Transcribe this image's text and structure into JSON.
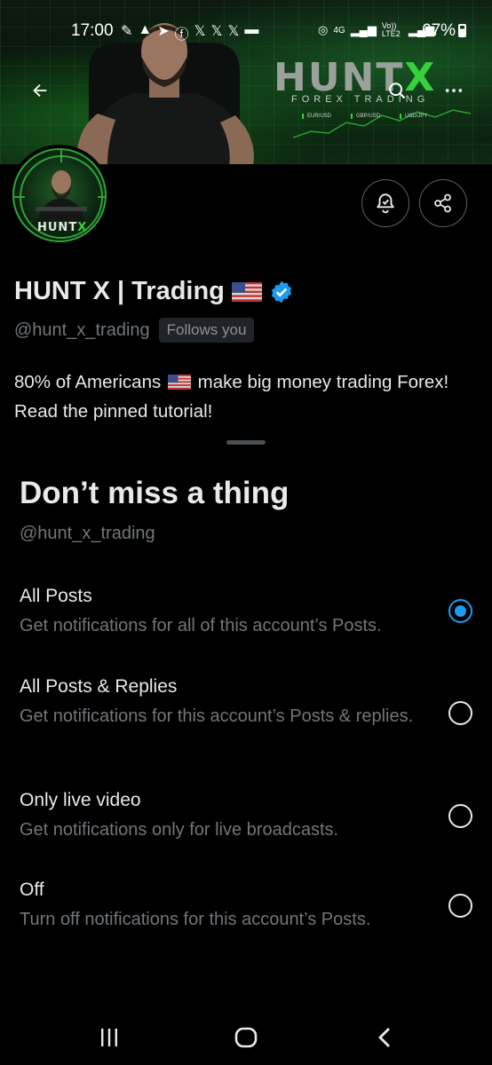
{
  "status_bar": {
    "time": "17:00",
    "left_icons": [
      "edit-icon",
      "alert-icon",
      "telegram-icon",
      "facebook-icon",
      "x-icon",
      "x-icon",
      "x-icon",
      "folder-icon"
    ],
    "right_icons": [
      "hotspot-icon",
      "4g-icon",
      "signal-icon",
      "volte-icon",
      "signal-icon"
    ],
    "network": "4G",
    "volte": "Vo)) LTE2",
    "battery": "67%"
  },
  "banner": {
    "brand_main": "HUNT",
    "brand_x": "X",
    "brand_sub": "FOREX TRADING",
    "tickers": [
      "EUR/USD",
      "GBP/USD",
      "USD/JPY"
    ]
  },
  "header": {
    "back_icon": "arrow-left-icon",
    "search_icon": "search-icon",
    "more_icon": "more-icon"
  },
  "avatar": {
    "label_main": "HUNT",
    "label_x": "X"
  },
  "actions": {
    "notify_icon": "bell-check-icon",
    "share_icon": "share-icon"
  },
  "profile": {
    "name": "HUNT X | Trading",
    "handle": "@hunt_x_trading",
    "follows_badge": "Follows you",
    "bio_line1_a": "80% of Americans",
    "bio_line1_b": "make big money trading Forex!",
    "bio_line2": "Read the pinned tutorial!"
  },
  "sheet": {
    "title": "Don’t miss a thing",
    "handle": "@hunt_x_trading",
    "options": [
      {
        "title": "All Posts",
        "description": "Get notifications for all of this account’s Posts.",
        "selected": true
      },
      {
        "title": "All Posts & Replies",
        "description": "Get notifications for this account’s Posts & replies.",
        "selected": false
      },
      {
        "title": "Only live video",
        "description": "Get notifications only for live broadcasts.",
        "selected": false
      },
      {
        "title": "Off",
        "description": "Turn off notifications for this account’s Posts.",
        "selected": false
      }
    ]
  },
  "colors": {
    "accent": "#1d9bf0",
    "brand_green": "#35d13f",
    "muted_text": "#71767b",
    "primary_text": "#e7e9ea",
    "background": "#000000"
  },
  "navbar": {
    "recents_icon": "recents-icon",
    "home_icon": "home-icon",
    "back_icon": "back-chevron-icon"
  }
}
